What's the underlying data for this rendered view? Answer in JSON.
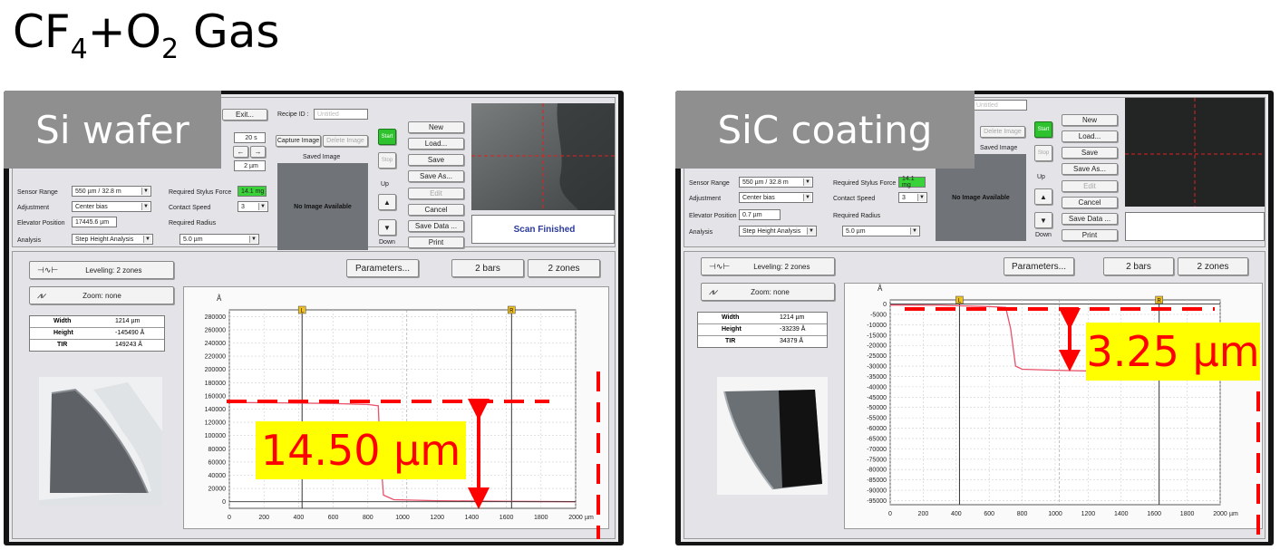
{
  "page": {
    "title_main": "CF",
    "title_sub1": "4",
    "title_plus": "+O",
    "title_sub2": "2",
    "title_gas": "Gas"
  },
  "colors": {
    "trace": "#e8526a",
    "annotation": "#ff0000",
    "highlight": "#ffff00",
    "label_bg": "#8f8f8f"
  },
  "left": {
    "label": "Si wafer",
    "toolbar": {
      "exit": "Exit...",
      "recipe_id_label": "Recipe ID :",
      "recipe_id_value": "Untitled",
      "capture_image": "Capture Image",
      "delete_image": "Delete Image",
      "saved_image": "Saved Image",
      "no_image": "No Image Available",
      "time": "20 s",
      "length": "2 µm",
      "scan_status": "Scan Finished"
    },
    "settings": {
      "sensor_range_label": "Sensor Range",
      "sensor_range_value": "550 µm / 32.8 m",
      "adjustment_label": "Adjustment",
      "adjustment_value": "Center bias",
      "elevator_label": "Elevator Position",
      "elevator_value": "17445.6 µm",
      "analysis_label": "Analysis",
      "analysis_value": "Step Height Analysis",
      "stylus_force_label": "Required Stylus Force",
      "stylus_force_value": "14.1 mg",
      "contact_speed_label": "Contact Speed",
      "contact_speed_value": "3",
      "radius_label": "Required Radius",
      "radius_value": "5.0 µm"
    },
    "controls": {
      "start": "Start",
      "stop": "Stop",
      "up": "Up",
      "down": "Down",
      "new": "New",
      "load": "Load...",
      "save": "Save",
      "save_as": "Save As...",
      "edit": "Edit",
      "cancel": "Cancel",
      "save_data": "Save Data ...",
      "print": "Print"
    },
    "analysis_bar": {
      "leveling": "Leveling: 2 zones",
      "zoom": "Zoom: none",
      "parameters": "Parameters...",
      "bars": "2 bars",
      "zones": "2 zones"
    },
    "measurements": [
      {
        "name": "Width",
        "value": "1214 µm"
      },
      {
        "name": "Height",
        "value": "-145490 Å"
      },
      {
        "name": "TIR",
        "value": "149243 Å"
      }
    ],
    "annotation": "14.50 µm",
    "chart_data": {
      "type": "line",
      "ylabel": "Å",
      "xunit": "µm",
      "xlim": [
        0,
        2000
      ],
      "ylim": [
        -10000,
        290000
      ],
      "x_ticks": [
        "0",
        "200",
        "400",
        "600",
        "800",
        "1000",
        "1200",
        "1400",
        "1600",
        "1800",
        "2000"
      ],
      "y_ticks": [
        "0",
        "20000",
        "40000",
        "60000",
        "80000",
        "100000",
        "120000",
        "140000",
        "160000",
        "180000",
        "200000",
        "220000",
        "240000",
        "260000",
        "280000"
      ],
      "cursors": [
        {
          "label": "L",
          "x": 420
        },
        {
          "label": "R",
          "x": 1630
        }
      ],
      "series": [
        {
          "points": [
            [
              0,
              150000
            ],
            [
              300,
              149500
            ],
            [
              600,
              148500
            ],
            [
              800,
              147000
            ],
            [
              860,
              145000
            ],
            [
              870,
              80000
            ],
            [
              890,
              10000
            ],
            [
              950,
              3000
            ],
            [
              1200,
              1500
            ],
            [
              1600,
              500
            ],
            [
              2000,
              0
            ]
          ]
        }
      ]
    }
  },
  "right": {
    "label": "SiC coating",
    "toolbar": {
      "recipe_id_value": "Untitled",
      "delete_image": "Delete Image",
      "saved_image": "Saved Image",
      "no_image": "No Image Available"
    },
    "settings": {
      "sensor_range_label": "Sensor Range",
      "sensor_range_value": "550 µm / 32.8 m",
      "adjustment_label": "Adjustment",
      "adjustment_value": "Center bias",
      "elevator_label": "Elevator Position",
      "elevator_value": "0.7 µm",
      "analysis_label": "Analysis",
      "analysis_value": "Step Height Analysis",
      "stylus_force_label": "Required Stylus Force",
      "stylus_force_value": "14.1 mg",
      "contact_speed_label": "Contact Speed",
      "contact_speed_value": "3",
      "radius_label": "Required Radius",
      "radius_value": "5.0 µm"
    },
    "controls": {
      "start": "Start",
      "stop": "Stop",
      "up": "Up",
      "down": "Down",
      "new": "New",
      "load": "Load...",
      "save": "Save",
      "save_as": "Save As...",
      "edit": "Edit",
      "cancel": "Cancel",
      "save_data": "Save Data ...",
      "print": "Print"
    },
    "analysis_bar": {
      "leveling": "Leveling: 2 zones",
      "zoom": "Zoom: none",
      "parameters": "Parameters...",
      "bars": "2 bars",
      "zones": "2 zones"
    },
    "measurements": [
      {
        "name": "Width",
        "value": "1214 µm"
      },
      {
        "name": "Height",
        "value": "-33239 Å"
      },
      {
        "name": "TIR",
        "value": "34379 Å"
      }
    ],
    "annotation": "3.25 µm",
    "chart_data": {
      "type": "line",
      "ylabel": "Å",
      "xunit": "µm",
      "xlim": [
        0,
        2000
      ],
      "ylim": [
        -97000,
        2000
      ],
      "x_ticks": [
        "0",
        "200",
        "400",
        "600",
        "800",
        "1000",
        "1200",
        "1400",
        "1600",
        "1800",
        "2000"
      ],
      "y_ticks": [
        "0",
        "-5000",
        "-10000",
        "-15000",
        "-20000",
        "-25000",
        "-30000",
        "-35000",
        "-40000",
        "-45000",
        "-50000",
        "-55000",
        "-60000",
        "-65000",
        "-70000",
        "-75000",
        "-80000",
        "-85000",
        "-90000",
        "-95000"
      ],
      "cursors": [
        {
          "label": "L",
          "x": 420
        },
        {
          "label": "R",
          "x": 1630
        }
      ],
      "series": [
        {
          "points": [
            [
              0,
              -500
            ],
            [
              300,
              -600
            ],
            [
              600,
              -1200
            ],
            [
              700,
              -1600
            ],
            [
              730,
              -12000
            ],
            [
              760,
              -30000
            ],
            [
              800,
              -31500
            ],
            [
              1000,
              -32000
            ],
            [
              1300,
              -32500
            ],
            [
              1600,
              -33000
            ]
          ]
        }
      ]
    }
  }
}
